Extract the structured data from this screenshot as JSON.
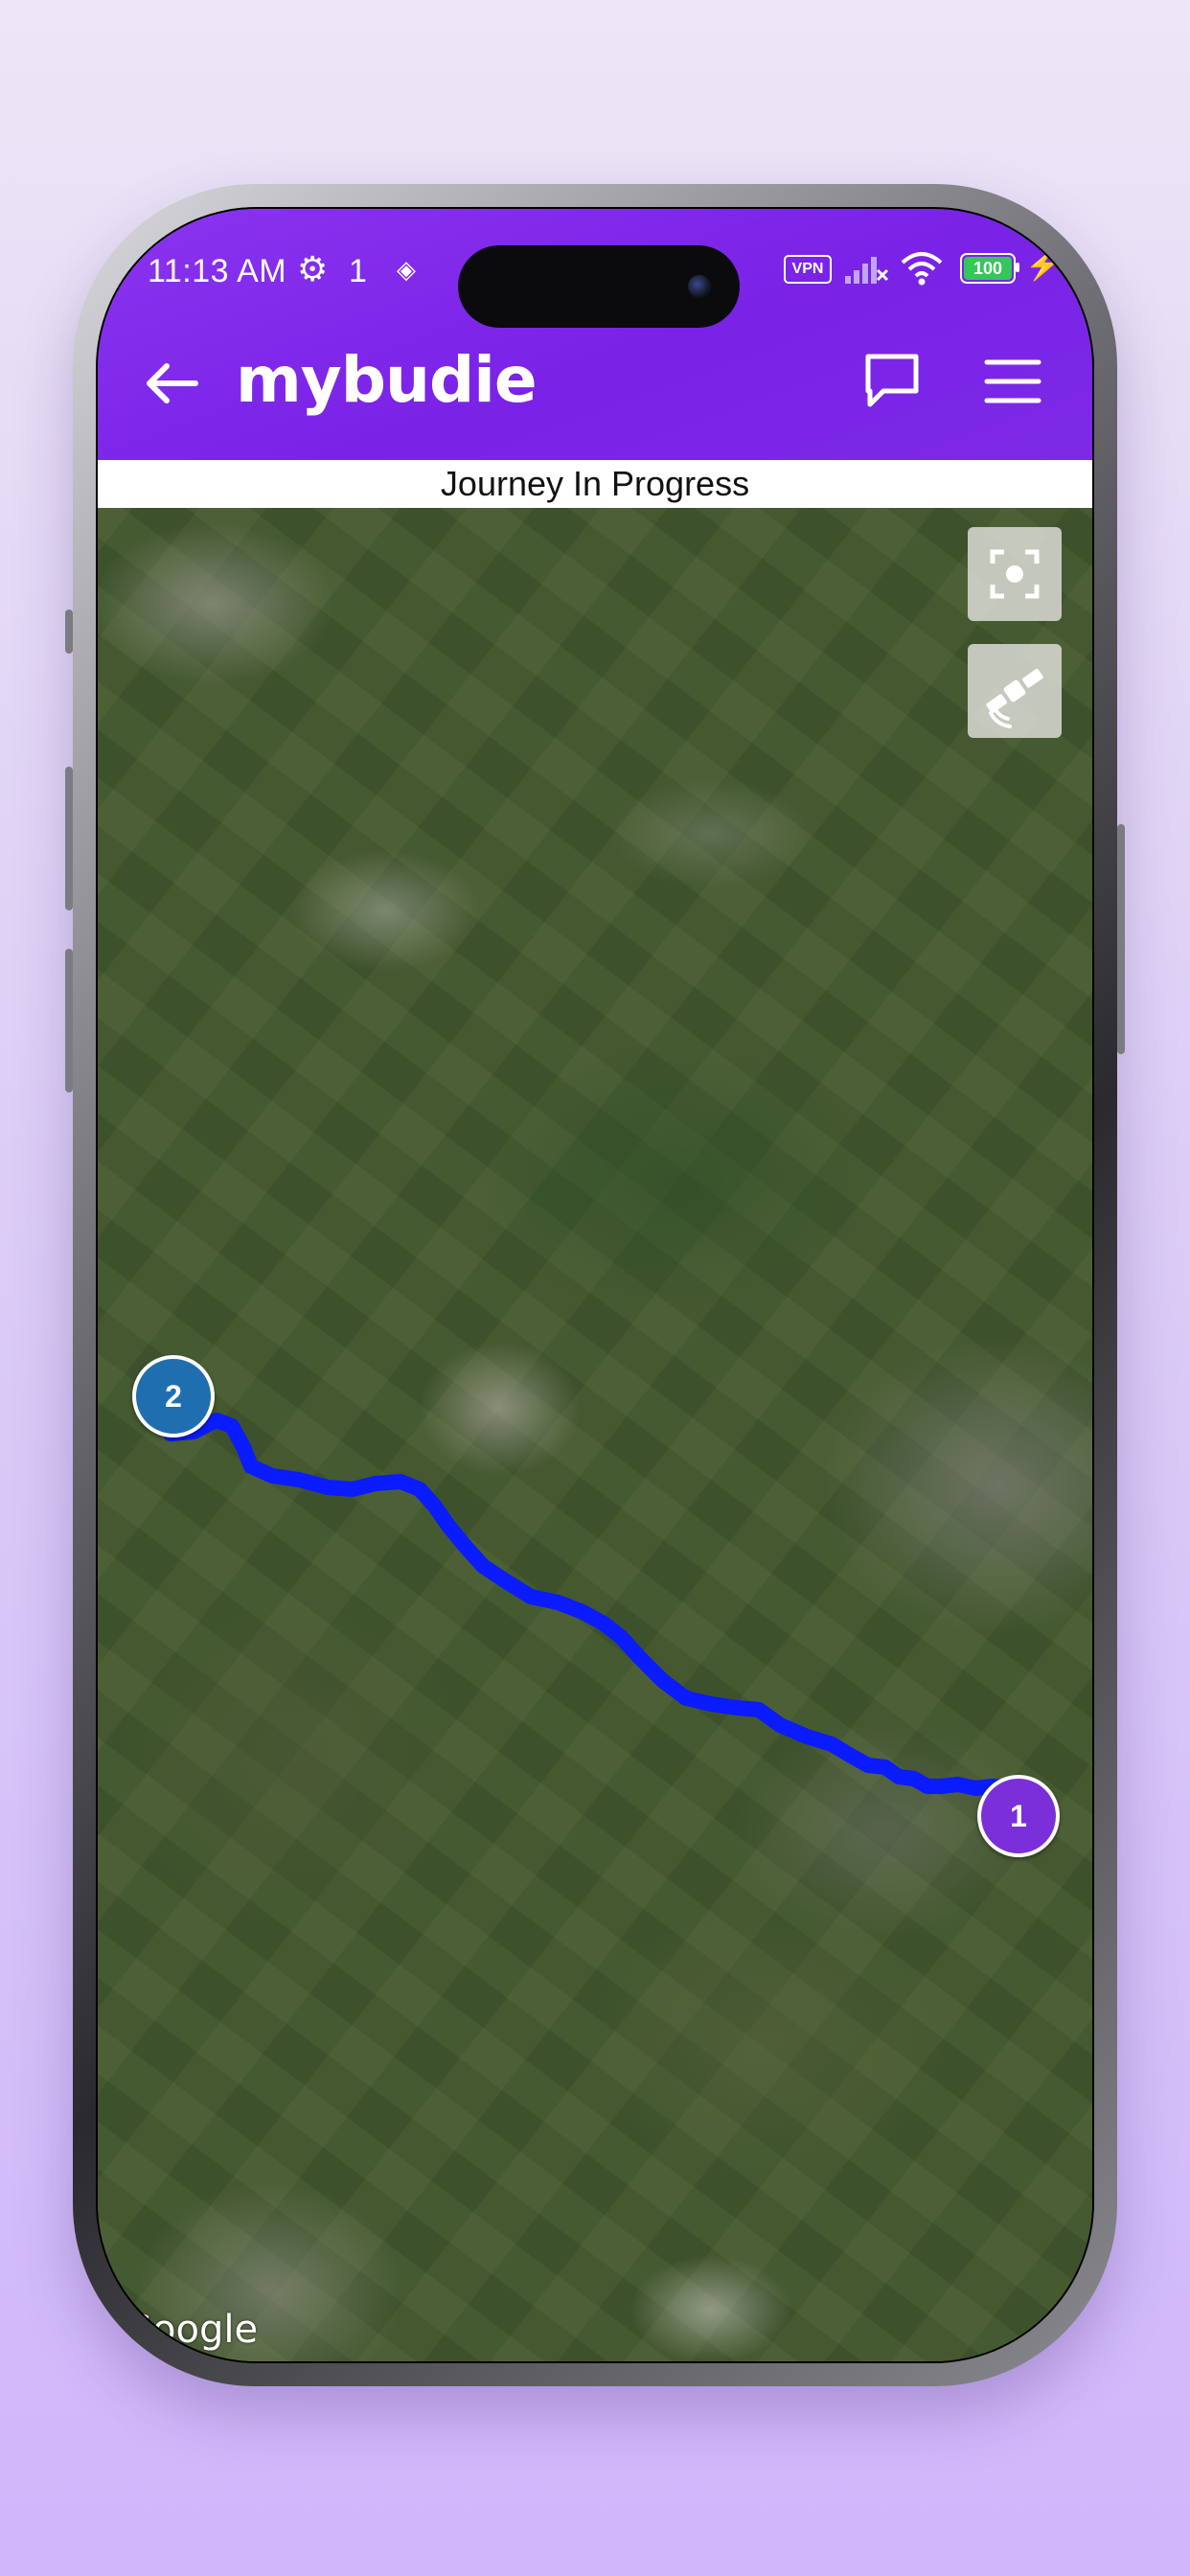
{
  "status_bar": {
    "time": "11:13 AM",
    "notification_count": "1",
    "vpn_label": "VPN",
    "battery_level": "100"
  },
  "header": {
    "logo": "mybudie",
    "back_icon": "arrow-left-icon",
    "chat_icon": "chat-bubble-icon",
    "menu_icon": "hamburger-menu-icon",
    "brand_color": "#7a22e6"
  },
  "journey": {
    "status_text": "Journey In Progress"
  },
  "map": {
    "type": "satellite",
    "controls": [
      {
        "name": "locate",
        "icon": "crosshair-focus-icon"
      },
      {
        "name": "satellite",
        "icon": "satellite-icon"
      }
    ],
    "markers": [
      {
        "label": "1",
        "color": "#7a2fd8"
      },
      {
        "label": "2",
        "color": "#1f6fb0"
      }
    ],
    "route_color": "#0a1bff",
    "attribution": "Google"
  }
}
